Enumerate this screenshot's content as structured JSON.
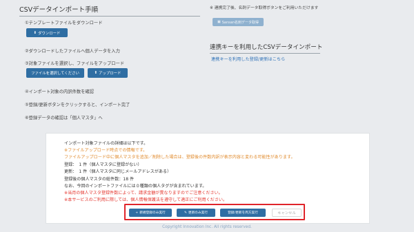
{
  "left": {
    "title": "CSVデータインポート手順",
    "step1": "①テンプレートファイルをダウンロード",
    "download_button": "ダウンロード",
    "step2": "②ダウンロードしたファイルへ個人データを入力",
    "step3": "③対象ファイルを選択し、ファイルをアップロード",
    "select_file_button": "ファイルを選択してください",
    "upload_button": "アップロード",
    "step4": "④インポート対象の内訳件数を確認",
    "step5": "⑤登録/更新ボタンをクリックすると、インポート完了",
    "step6": "⑥登録データの確認は「個人マスタ」へ"
  },
  "right": {
    "note": "※ 連携完了後、名刺データ取得ボタンをご利用いただけます",
    "sansan_button": "Sansan名刺データ取得",
    "title": "連携キーを利用したCSVデータインポート",
    "link": "連携キーを利用した登録/更新はこちら"
  },
  "panel": {
    "line1": "インポート対象ファイルの詳細は以下です。",
    "line2": "※ファイルアップロード時点での情報です。",
    "line3": "ファイルアップロード中に個人マスタを追加／削除した場合は、登録後の件数内訳が表示内容と変わる可能性があります。",
    "line4": "登録：　1 件（個人マスタに登録がない）",
    "line5": "更新：　1 件（個人マスタに同じメールアドレスがある）",
    "line6": "登録後の個人マスタの総件数：18 件",
    "line7": "なお、今回のインポートファイルには０種類の個人タグが含まれています。",
    "line8": "※当月の個人マスタ登録件数によって、請求金額が異なりますのでご注意ください。",
    "line9": "※本サービスのご利用に際しては、個人情報保護法を遵守して適正にご利用ください。",
    "buttons": {
      "new_only": "新規登録のみ実行",
      "update_only": "更新のみ実行",
      "both": "登録/更新を両方実行",
      "cancel": "キャンセル"
    }
  },
  "footer": "Copyright Innovation Inc. All rights reserved.",
  "colors": {
    "primary": "#2f6ea3",
    "highlight_border": "#e0242a",
    "warning_orange": "#e08a2c",
    "alert_red": "#e4342c",
    "link": "#2f72b8"
  }
}
